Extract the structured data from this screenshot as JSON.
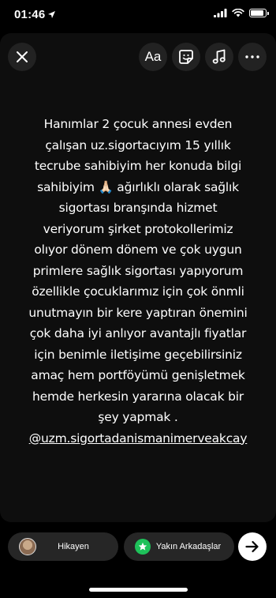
{
  "status_bar": {
    "time": "01:46"
  },
  "toolbar": {
    "text_label": "Aa"
  },
  "story": {
    "lines": [
      "Hanımlar 2 çocuk annesi evden",
      "çalışan uz.sigortacıyım 15 yıllık",
      "tecrube sahibiyim her konuda bilgi",
      "sahibiyim 🙏🏻 ağırlıklı olarak sağlık",
      "sigortası branşında hizmet",
      "veriyorum şirket protokollerimiz",
      "olıyor dönem dönem ve çok uygun",
      "primlere sağlık sigortası yapıyorum",
      "özellikle çocuklarımız için çok önmli",
      "unutmayın bir kere yaptıran önemini",
      "çok daha iyi anlıyor avantajlı fiyatlar",
      "için benimle iletişime geçebilirsiniz",
      "amaç hem portföyümü genişletmek",
      "hemde herkesin yararına olacak bir",
      "şey yapmak ."
    ],
    "handle": "@uzm.sigortadanismanimerveakcay"
  },
  "share_bar": {
    "story_label": "Hikayen",
    "close_friends_label": "Yakın Arkadaşlar"
  },
  "colors": {
    "background": "#000000",
    "card": "#0e0e0e",
    "pill": "#262626",
    "close_friends_green": "#1ec15a"
  }
}
